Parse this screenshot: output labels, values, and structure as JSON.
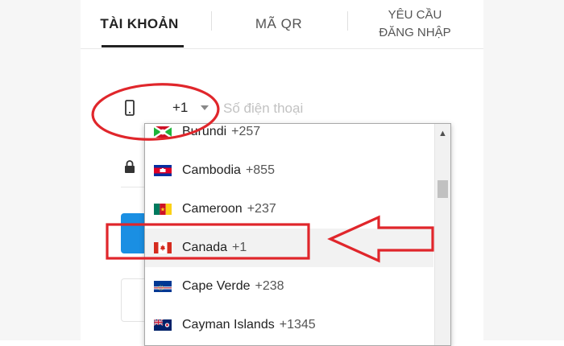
{
  "tabs": {
    "account": "TÀI KHOẢN",
    "qr": "MÃ QR",
    "request_line1": "YÊU CẦU",
    "request_line2": "ĐĂNG NHẬP"
  },
  "phone": {
    "country_code": "+1",
    "placeholder": "Số điện thoại"
  },
  "dropdown": {
    "items": [
      {
        "name": "Burundi",
        "code": "+257",
        "flag": "flag-burundi-icon"
      },
      {
        "name": "Cambodia",
        "code": "+855",
        "flag": "flag-cambodia-icon"
      },
      {
        "name": "Cameroon",
        "code": "+237",
        "flag": "flag-cameroon-icon"
      },
      {
        "name": "Canada",
        "code": "+1",
        "flag": "flag-canada-icon",
        "selected": true
      },
      {
        "name": "Cape Verde",
        "code": "+238",
        "flag": "flag-cape-verde-icon"
      },
      {
        "name": "Cayman Islands",
        "code": "+1345",
        "flag": "flag-cayman-islands-icon"
      }
    ]
  },
  "colors": {
    "annotation_red": "#e0262b",
    "login_blue": "#1a8fe3"
  }
}
